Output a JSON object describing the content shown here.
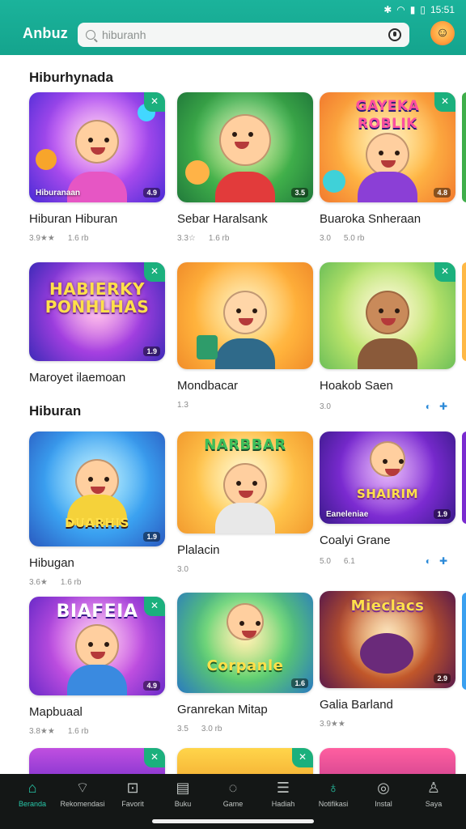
{
  "status_bar": {
    "time": "15:51",
    "icons": [
      "bluetooth-icon",
      "wifi-icon",
      "signal-icon",
      "battery-icon"
    ]
  },
  "app": {
    "title": "Anbuz"
  },
  "search": {
    "placeholder": "hiburanh"
  },
  "sections": {
    "s1": "Hiburhynada",
    "s2": "Hiburan"
  },
  "cards": [
    {
      "title": "Hiburan Hiburan",
      "rating": "3.9★★",
      "meta": "1.6 rb",
      "caption": "Hiburanaan",
      "tag": "4.9",
      "banner": ""
    },
    {
      "title": "Sebar Haralsank",
      "rating": "3.3☆",
      "meta": "1.6 rb",
      "caption": "",
      "tag": "3.5",
      "banner": ""
    },
    {
      "title": "Buaroka Snheraan",
      "rating": "3.0",
      "meta": "5.0 rb",
      "caption": "",
      "tag": "4.8",
      "banner": "GAYEKA ROBLIK"
    },
    {
      "title": "Maroyet ilaemoan",
      "rating": "",
      "meta": "",
      "caption": "",
      "tag": "1.9",
      "banner": "HABIERKY PONHLHAS"
    },
    {
      "title": "Mondbacar",
      "rating": "1.3",
      "meta": "",
      "caption": "",
      "tag": "",
      "banner": ""
    },
    {
      "title": "Hoakob Saen",
      "rating": "3.0",
      "meta": "",
      "caption": "",
      "tag": "",
      "banner": ""
    },
    {
      "title": "Hibugan",
      "rating": "3.6★",
      "meta": "1.6 rb",
      "caption": "",
      "tag": "1.9",
      "banner": "DUARHIS"
    },
    {
      "title": "Plalacin",
      "rating": "3.0",
      "meta": "",
      "caption": "",
      "tag": "",
      "banner": "NARBBAR"
    },
    {
      "title": "Coalyi Grane",
      "rating": "5.0",
      "meta": "6.1",
      "caption": "Eaneleniae",
      "tag": "1.9",
      "banner": "SHAIRIM"
    },
    {
      "title": "Mapbuaal",
      "rating": "3.8★★",
      "meta": "1.6 rb",
      "caption": "",
      "tag": "4.9",
      "banner": "BIAFEIA"
    },
    {
      "title": "Granrekan Mitap",
      "rating": "3.5",
      "meta": "3.0 rb",
      "caption": "",
      "tag": "1.6",
      "banner": "Corpanle"
    },
    {
      "title": "Galia Barland",
      "rating": "3.9★★",
      "meta": "",
      "caption": "",
      "tag": "2.9",
      "banner": "Mieclacs"
    }
  ],
  "bottom_nav": [
    {
      "label": "Beranda",
      "icon": "home-icon"
    },
    {
      "label": "Rekomendasi",
      "icon": "tag-icon"
    },
    {
      "label": "Favorit",
      "icon": "gift-icon"
    },
    {
      "label": "Buku",
      "icon": "book-icon"
    },
    {
      "label": "Game",
      "icon": "chat-icon"
    },
    {
      "label": "Hadiah",
      "icon": "list-icon"
    },
    {
      "label": "Notifikasi",
      "icon": "bell-icon"
    },
    {
      "label": "Instal",
      "icon": "camera-icon"
    },
    {
      "label": "Saya",
      "icon": "person-icon"
    }
  ],
  "colors": {
    "accent": "#1bb39b",
    "nav_bg": "#141716",
    "nav_active": "#27c7a8",
    "badge_green": "#1bb07d"
  }
}
